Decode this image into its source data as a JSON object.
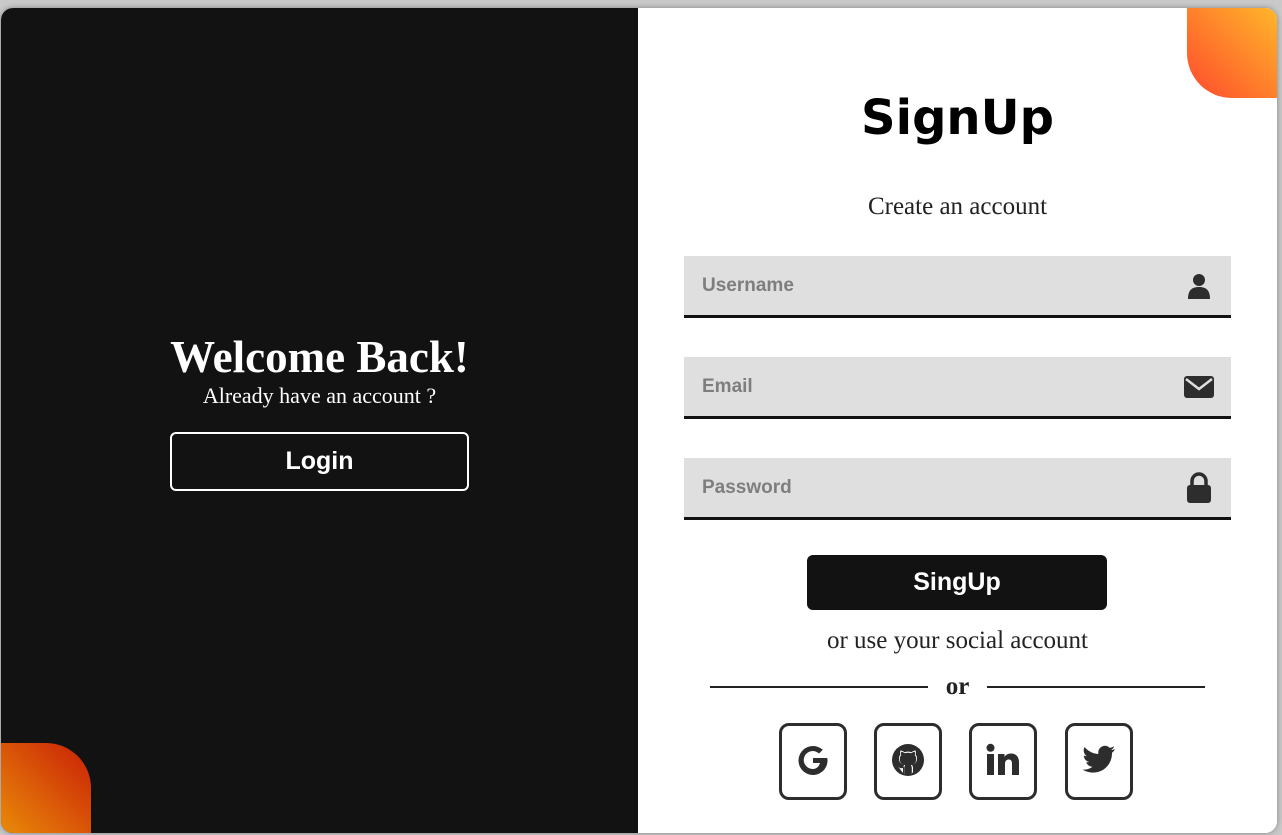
{
  "left_panel": {
    "heading": "Welcome Back!",
    "subtext": "Already have an account ?",
    "login_label": "Login"
  },
  "right_panel": {
    "title": "SignUp",
    "subtitle": "Create an account",
    "fields": {
      "username": {
        "placeholder": "Username",
        "value": "",
        "icon": "user-icon"
      },
      "email": {
        "placeholder": "Email",
        "value": "",
        "icon": "envelope-icon"
      },
      "password": {
        "placeholder": "Password",
        "value": "",
        "icon": "lock-icon"
      }
    },
    "submit_label": "SingUp",
    "social_text": "or use your social account",
    "divider_text": "or",
    "social_buttons": [
      {
        "name": "google",
        "icon": "google-icon"
      },
      {
        "name": "github",
        "icon": "github-icon"
      },
      {
        "name": "linkedin",
        "icon": "linkedin-icon"
      },
      {
        "name": "twitter",
        "icon": "twitter-icon"
      }
    ]
  },
  "colors": {
    "dark_panel": "#121212",
    "field_bg": "#dfdfdf",
    "accent_top_right": [
      "#ffb62a",
      "#ff4a2c"
    ],
    "accent_bottom_left": [
      "#e98a09",
      "#c91f06"
    ]
  }
}
